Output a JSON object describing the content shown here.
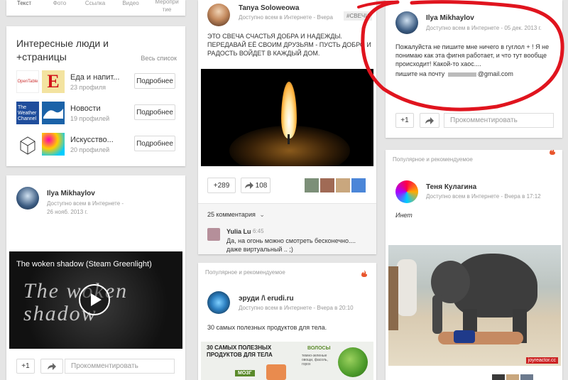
{
  "top_tabs": [
    "Текст",
    "Фото",
    "Ссылка",
    "Видео",
    "Меропри\nтие"
  ],
  "people": {
    "title": "Интересные люди и\n+страницы",
    "all_link": "Весь список",
    "button": "Подробнее",
    "items": [
      {
        "name": "Еда и напит...",
        "count": "23 профиля"
      },
      {
        "name": "Новости",
        "count": "19 профилей"
      },
      {
        "name": "Искусство...",
        "count": "20 профилей"
      }
    ]
  },
  "post_ilya_left": {
    "name": "Ilya Mikhaylov",
    "meta": "Доступно всем в Интернете -\n26 нояб. 2013 г.",
    "video_title": "The woken shadow (Steam Greenlight)",
    "video_art": "The woken\nshadow",
    "plus": "+1",
    "comment_placeholder": "Прокомментировать"
  },
  "post_tanya": {
    "name": "Tanya Soloweowa",
    "meta": "Доступно всем в Интернете - Вчера",
    "tag": "#СВЕЧИ",
    "text": "ЭТО СВЕЧА СЧАСТЬЯ ДОБРА И НАДЕЖДЫ. ПЕРЕДАВАЙ ЕЁ СВОИМ ДРУЗЬЯМ - ПУСТЬ ДОБРО И РАДОСТЬ ВОЙДЕТ В КАЖДЫЙ ДОМ.",
    "plus": "+289",
    "shares": "108",
    "comments_count": "25 комментария",
    "commenter": "Yulia Lu",
    "comment_time": "6:45",
    "comment_text": "Да, на огонь можно смотреть бесконечно.... даже виртуальный .. ;)"
  },
  "post_erudi": {
    "section": "Популярное и рекомендуемое",
    "name": "эруди /\\ erudi.ru",
    "meta": "Доступно всем в Интернете - Вчера в 20:10",
    "text": "30 самых полезных продуктов для тела.",
    "img_title": "30 САМЫХ ПОЛЕЗНЫХ\nПРОДУКТОВ ДЛЯ ТЕЛА",
    "img_label1": "МОЗГ",
    "img_label2": "ВОЛОСЫ",
    "img_small": "темно-зеленые\nовощи, фасоль,\nгорох"
  },
  "post_ilya_right": {
    "name": "Ilya Mikhaylov",
    "meta": "Доступно всем в Интернете - 05 дек. 2013 г.",
    "text": "Пожалуйста не пишите мне ничего в гуглол + ! Я не понимаю как эта фигня работает, и что тут вообще происходит! Какой-то хаос....",
    "email_prefix": "пишите на почту",
    "email_suffix": "@gmail.com",
    "plus": "+1",
    "comment_placeholder": "Прокомментировать"
  },
  "post_tenya": {
    "section": "Популярное и рекомендуемое",
    "name": "Теня Кулагина",
    "meta": "Доступно всем в Интернете - Вчера в 17:12",
    "text": "Инет",
    "watermark": "joyreactor.cc"
  },
  "colors": {
    "red_highlight": "#e0141e",
    "fire": "#e8552c",
    "link_blue": "#427fed"
  }
}
